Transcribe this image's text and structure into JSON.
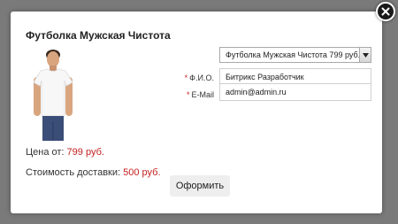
{
  "modal": {
    "title": "Футболка Мужская Чистота",
    "close_icon": "close-icon",
    "product_image_icon": "tshirt-man-photo"
  },
  "price": {
    "label": "Цена от:",
    "value": "799 руб."
  },
  "delivery": {
    "label": "Стоимость доставки:",
    "value": "500 руб."
  },
  "form": {
    "product_select": {
      "selected": "Футболка Мужская Чистота 799 руб."
    },
    "name_field": {
      "required_mark": "*",
      "label": "Ф.И.О.",
      "value": "Битрикс Разработчик"
    },
    "email_field": {
      "required_mark": "*",
      "label": "E-Mail",
      "value": "admin@admin.ru"
    },
    "submit_label": "Оформить"
  },
  "colors": {
    "accent_red": "#c42222",
    "overlay": "#7a7a7a"
  }
}
